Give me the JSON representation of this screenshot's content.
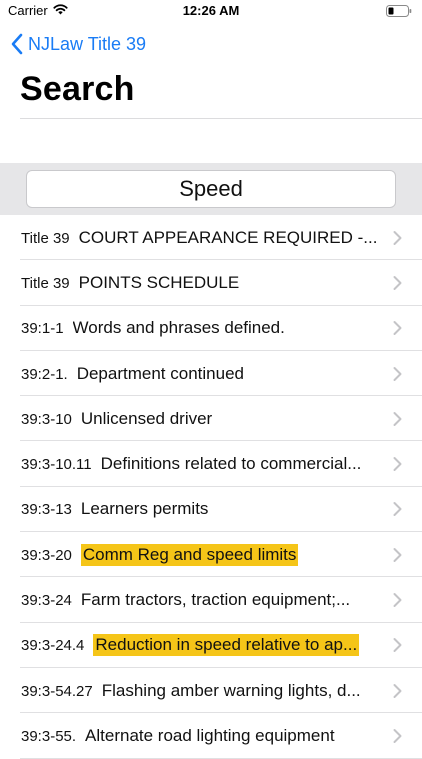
{
  "status_bar": {
    "carrier": "Carrier",
    "time": "12:26 AM",
    "icons": [
      "wifi-icon",
      "battery-icon"
    ]
  },
  "nav": {
    "back_label": "NJLaw Title 39",
    "title": "Search"
  },
  "search": {
    "value": "Speed"
  },
  "colors": {
    "accent": "#1a7cf5",
    "highlight": "#f5c518",
    "search_band": "#e6e6e8"
  },
  "results": [
    {
      "num": "Title 39",
      "title": "COURT APPEARANCE REQUIRED -...",
      "highlighted": false
    },
    {
      "num": "Title 39",
      "title": "POINTS SCHEDULE",
      "highlighted": false
    },
    {
      "num": "39:1-1",
      "title": "Words and phrases defined.",
      "highlighted": false
    },
    {
      "num": "39:2-1.",
      "title": "Department continued",
      "highlighted": false
    },
    {
      "num": "39:3-10",
      "title": "Unlicensed driver",
      "highlighted": false
    },
    {
      "num": "39:3-10.11",
      "title": "Definitions related to commercial...",
      "highlighted": false
    },
    {
      "num": "39:3-13",
      "title": "Learners permits",
      "highlighted": false
    },
    {
      "num": "39:3-20",
      "title": "Comm Reg and speed limits",
      "highlighted": true
    },
    {
      "num": "39:3-24",
      "title": "Farm tractors, traction equipment;...",
      "highlighted": false
    },
    {
      "num": "39:3-24.4",
      "title": "Reduction in speed relative to ap...",
      "highlighted": true
    },
    {
      "num": "39:3-54.27",
      "title": "Flashing amber warning lights, d...",
      "highlighted": false
    },
    {
      "num": "39:3-55.",
      "title": "Alternate road lighting equipment",
      "highlighted": false
    }
  ]
}
